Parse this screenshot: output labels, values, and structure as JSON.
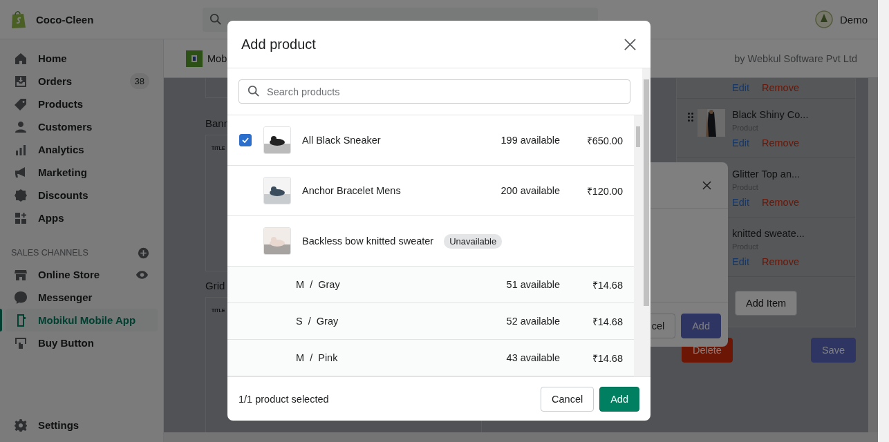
{
  "store": {
    "name": "Coco-Cleen"
  },
  "account": {
    "name": "Demo"
  },
  "nav": [
    {
      "label": "Home",
      "selected": false
    },
    {
      "label": "Orders",
      "badge": "38",
      "selected": false
    },
    {
      "label": "Products",
      "selected": false
    },
    {
      "label": "Customers",
      "selected": false
    },
    {
      "label": "Analytics",
      "selected": false
    },
    {
      "label": "Marketing",
      "selected": false
    },
    {
      "label": "Discounts",
      "selected": false
    },
    {
      "label": "Apps",
      "selected": false
    }
  ],
  "sales_channels": {
    "heading": "SALES CHANNELS",
    "items": [
      {
        "label": "Online Store",
        "selected": false
      },
      {
        "label": "Messenger",
        "selected": false
      },
      {
        "label": "Mobikul Mobile App",
        "selected": true
      },
      {
        "label": "Buy Button",
        "selected": false
      }
    ]
  },
  "settings": {
    "label": "Settings"
  },
  "page": {
    "title": "Mob",
    "byline": "by Webkul Software Pvt Ltd",
    "sections": [
      {
        "label": "Bann",
        "tag": "TITLE"
      },
      {
        "label": "Grid",
        "tag": "TITLE"
      }
    ],
    "items": [
      {
        "edit": "Edit",
        "remove": "Remove"
      },
      {
        "name": "Black Shiny Co...",
        "type": "Product",
        "edit": "Edit",
        "remove": "Remove"
      },
      {
        "name": "Glitter Top an...",
        "type": "Product",
        "edit": "Edit",
        "remove": "Remove"
      },
      {
        "name": "knitted sweate...",
        "type": "Product",
        "edit": "Edit",
        "remove": "Remove"
      }
    ],
    "add_item": "Add Item",
    "delete": "Delete",
    "save": "Save"
  },
  "back_dialog": {
    "cancel": "cel",
    "add": "Add"
  },
  "modal": {
    "title": "Add product",
    "search_placeholder": "Search products",
    "products": [
      {
        "name": "All Black Sneaker",
        "available": "199 available",
        "price": "₹650.00",
        "checked": true
      },
      {
        "name": "Anchor Bracelet Mens",
        "available": "200 available",
        "price": "₹120.00",
        "checked": false
      },
      {
        "name": "Backless bow knitted sweater",
        "badge": "Unavailable",
        "checked": false,
        "variants": [
          {
            "option": "M  /  Gray",
            "available": "51 available",
            "price": "₹14.68"
          },
          {
            "option": "S  /  Gray",
            "available": "52 available",
            "price": "₹14.68"
          },
          {
            "option": "M  /  Pink",
            "available": "43 available",
            "price": "₹14.68"
          }
        ]
      }
    ],
    "summary": "1/1 product selected",
    "cancel": "Cancel",
    "add": "Add"
  }
}
